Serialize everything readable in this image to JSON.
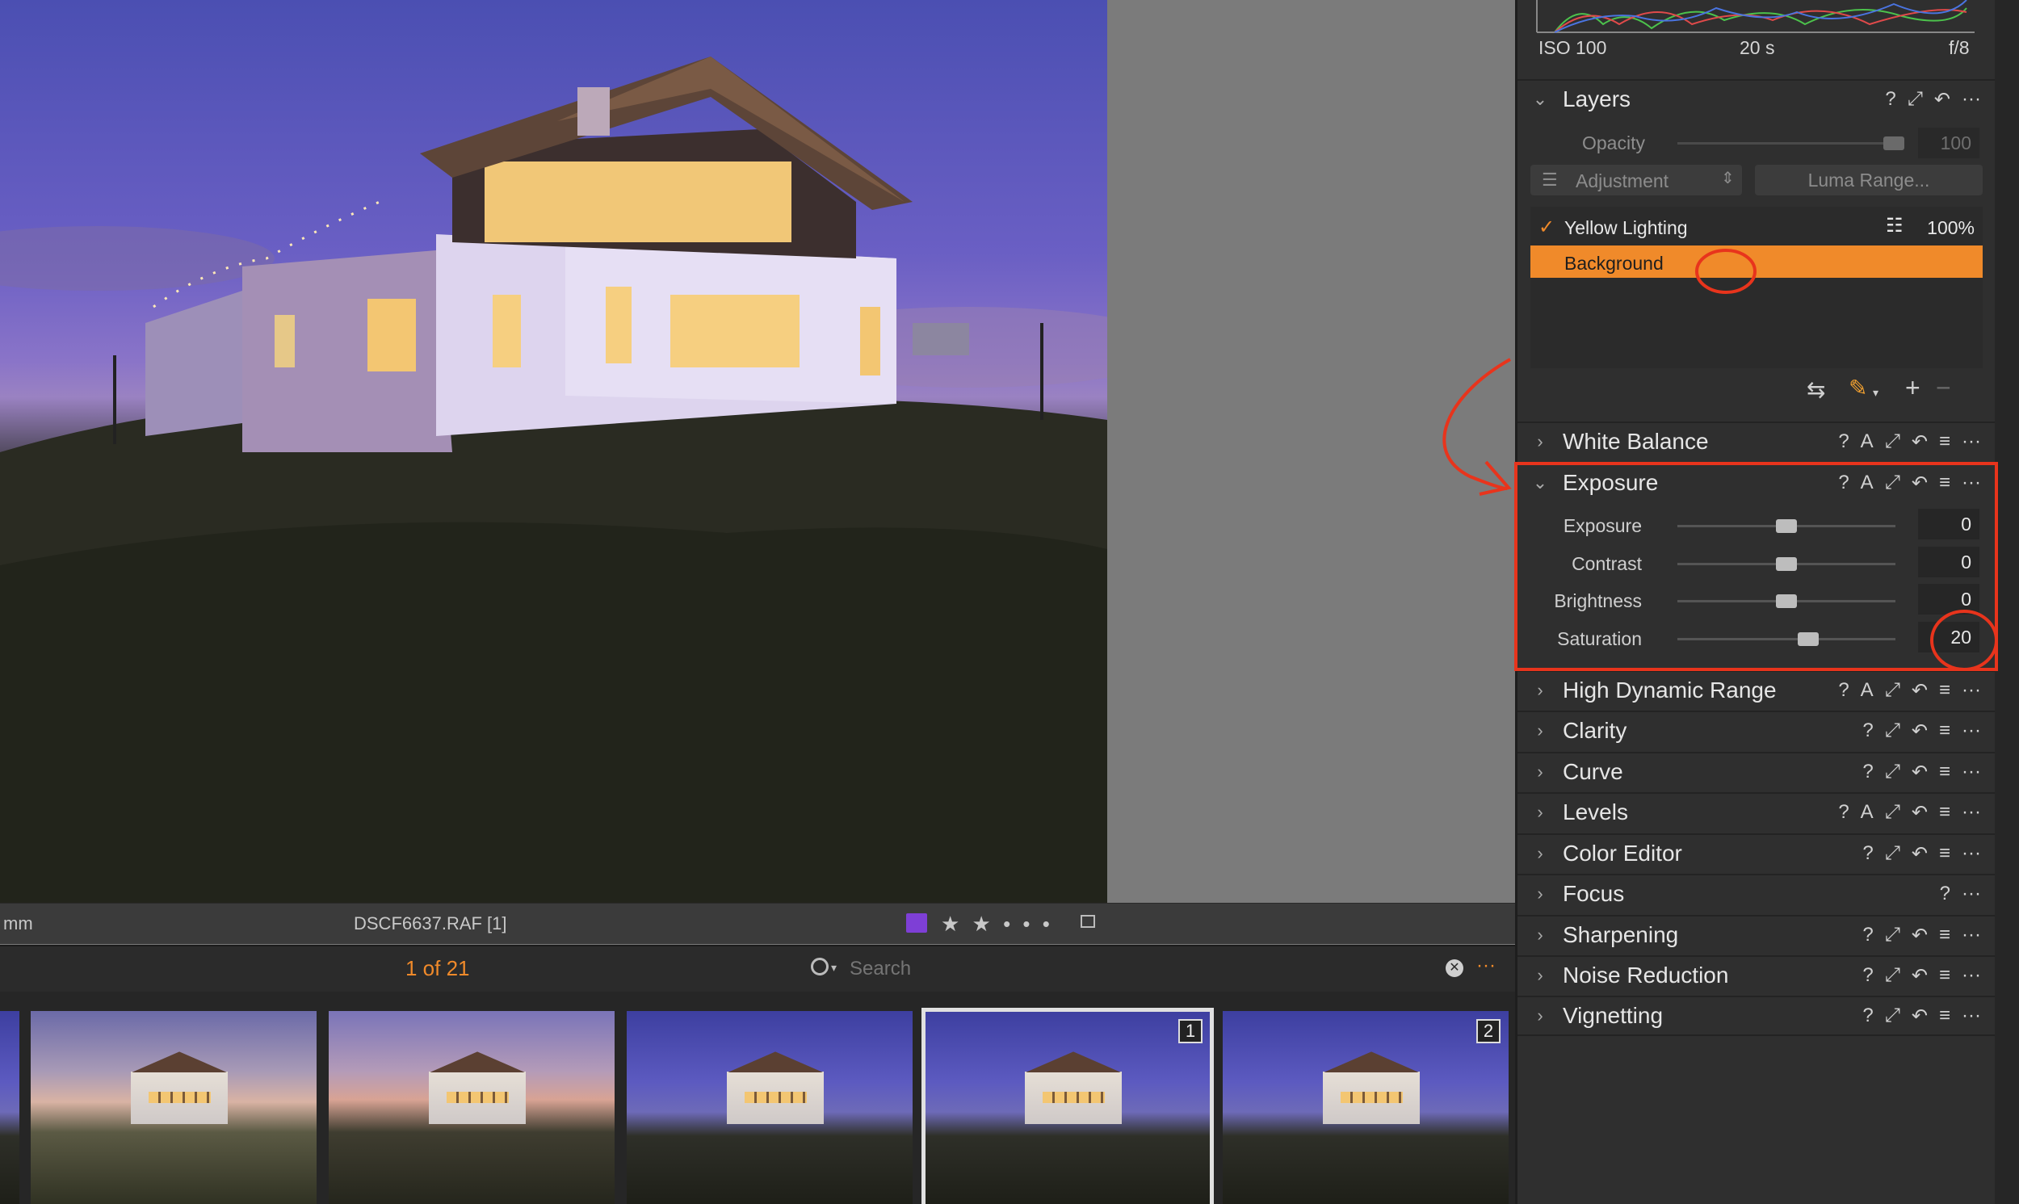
{
  "viewer": {
    "info_left": "mm",
    "filename": "DSCF6637.RAF [1]",
    "color_tag": "#7e3fd6",
    "rating": "★ ★ • • •"
  },
  "browser": {
    "count": "1 of 21",
    "search_placeholder": "Search"
  },
  "filmstrip": {
    "badges": [
      "1",
      "2"
    ]
  },
  "histogram": {
    "iso": "ISO 100",
    "shutter": "20 s",
    "aperture": "f/8"
  },
  "layers": {
    "title": "Layers",
    "opacity_label": "Opacity",
    "opacity_value": "100",
    "adjustment_select": "Adjustment",
    "luma_button": "Luma Range...",
    "items": [
      {
        "name": "Yellow Lighting",
        "percent": "100%"
      },
      {
        "name": "Background"
      }
    ]
  },
  "tools": {
    "white_balance": "White Balance",
    "exposure": "Exposure",
    "hdr": "High Dynamic Range",
    "clarity": "Clarity",
    "curve": "Curve",
    "levels": "Levels",
    "color_editor": "Color Editor",
    "focus": "Focus",
    "sharpening": "Sharpening",
    "noise_reduction": "Noise Reduction",
    "vignetting": "Vignetting"
  },
  "exposure_sliders": [
    {
      "label": "Exposure",
      "value": "0",
      "fraction": 0.5
    },
    {
      "label": "Contrast",
      "value": "0",
      "fraction": 0.5
    },
    {
      "label": "Brightness",
      "value": "0",
      "fraction": 0.5
    },
    {
      "label": "Saturation",
      "value": "20",
      "fraction": 0.6
    }
  ],
  "icons": {
    "help": "?",
    "auto": "A",
    "copy": "⤢",
    "reset": "↶",
    "list": "≡",
    "more": "···"
  },
  "colors": {
    "accent_orange": "#f08a2a",
    "annotation_red": "#e8341c",
    "panel_bg": "#2f2f2f"
  }
}
